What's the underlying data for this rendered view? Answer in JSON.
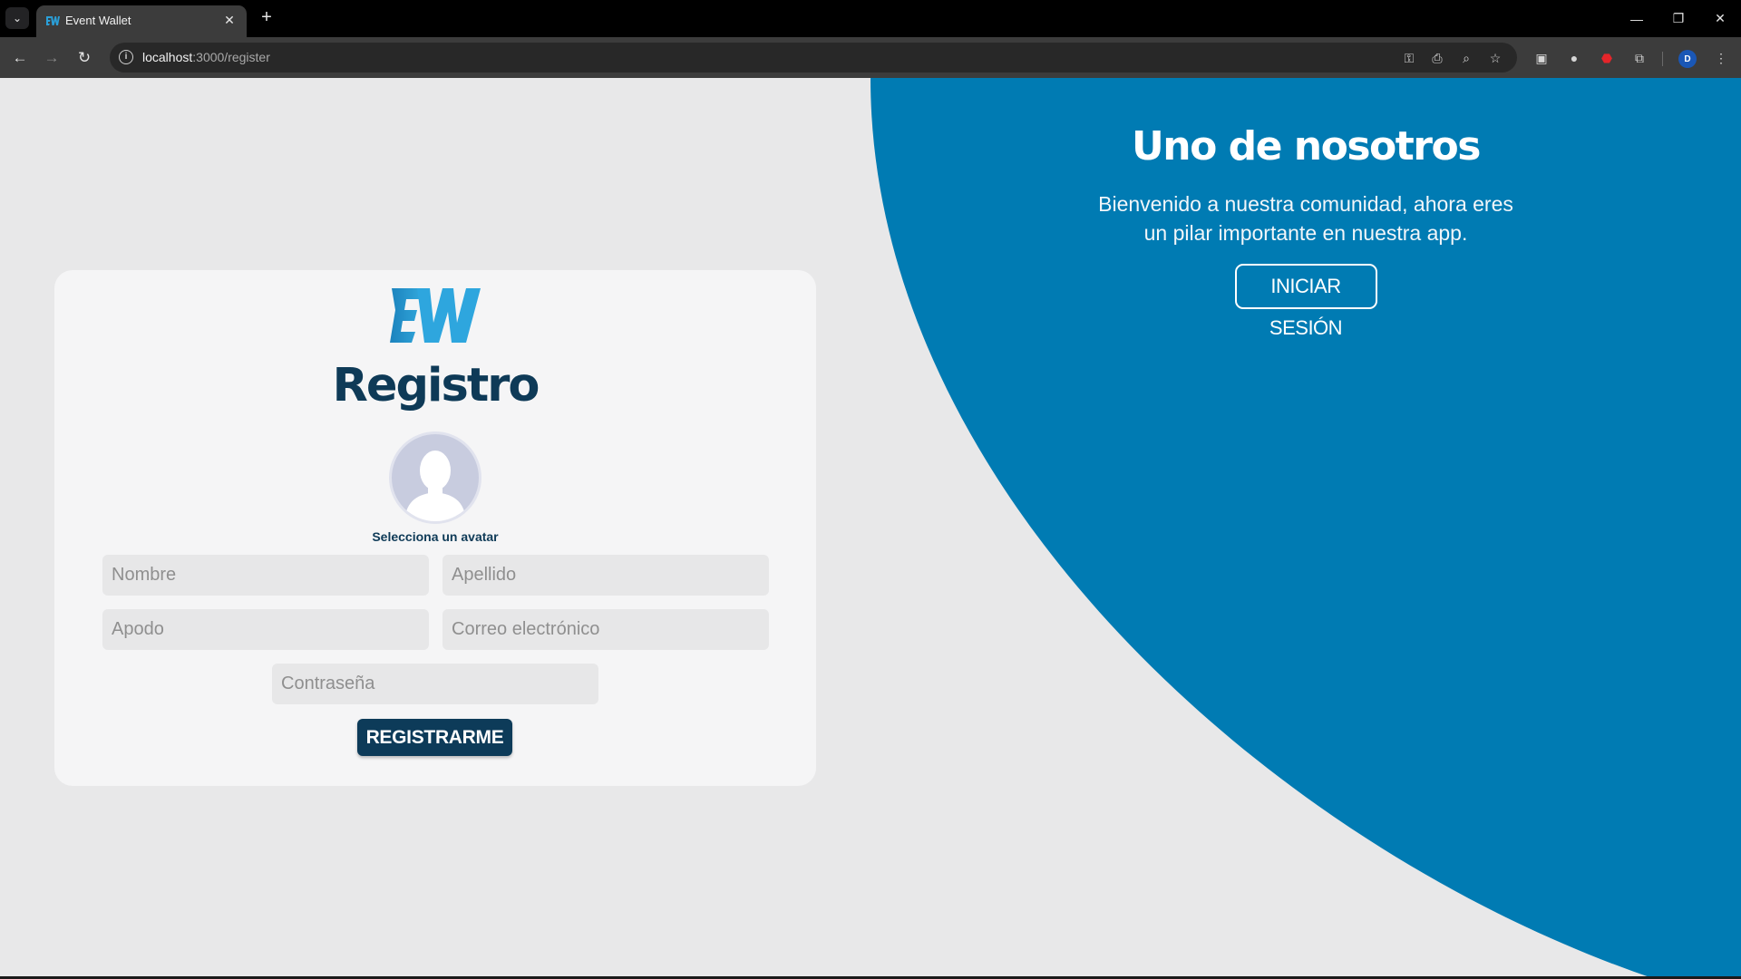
{
  "browser": {
    "tab_title": "Event Wallet",
    "url_host": "localhost",
    "url_path": ":3000/register",
    "profile_initial": "D"
  },
  "icons": {
    "tab_menu": "chevron-down-icon",
    "close": "close-icon",
    "new_tab": "plus-icon",
    "back": "back-arrow-icon",
    "forward": "forward-arrow-icon",
    "reload": "reload-icon",
    "site_info": "info-icon",
    "password": "key-icon",
    "install": "install-app-icon",
    "zoom": "zoom-icon",
    "bookmark": "star-icon",
    "extensions": "puzzle-icon",
    "menu": "kebab-menu-icon"
  },
  "colors": {
    "brand_blue": "#007bb3",
    "navy": "#0e3a57",
    "button_navy": "#0d3b59",
    "page_bg": "#e8e8e9",
    "card_bg": "#f5f5f6"
  },
  "welcome": {
    "title": "Uno de nosotros",
    "text": "Bienvenido a nuestra comunidad, ahora eres un pilar importante en nuestra app.",
    "login_button": "INICIAR SESIÓN"
  },
  "form": {
    "title": "Registro",
    "avatar_label": "Selecciona un avatar",
    "nombre_placeholder": "Nombre",
    "apellido_placeholder": "Apellido",
    "apodo_placeholder": "Apodo",
    "correo_placeholder": "Correo electrónico",
    "password_placeholder": "Contraseña",
    "submit_label": "REGISTRARME"
  }
}
